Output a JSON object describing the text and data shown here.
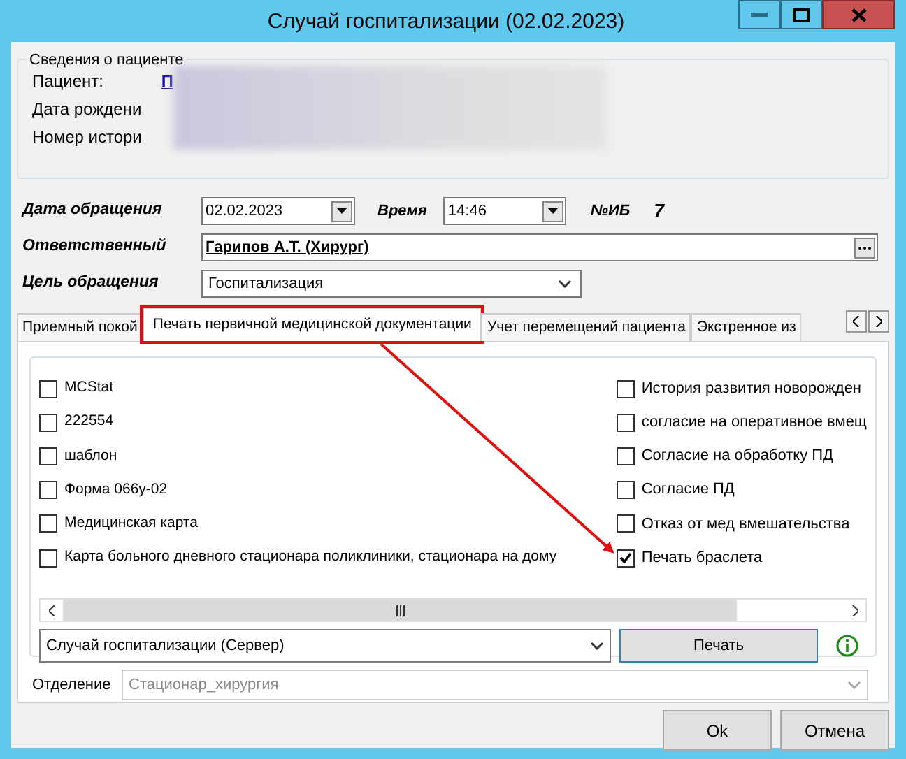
{
  "window": {
    "title": "Случай госпитализации (02.02.2023)"
  },
  "patient_info": {
    "legend": "Сведения о пациенте",
    "rows": [
      {
        "label": "Пациент:",
        "value": "П"
      },
      {
        "label": "Дата рождени"
      },
      {
        "label": "Номер истори"
      }
    ]
  },
  "visit": {
    "date_label": "Дата обращения",
    "date": "02.02.2023",
    "time_label": "Время",
    "time": "14:46",
    "ib_label": "№ИБ",
    "ib": "7",
    "responsible_label": "Ответственный",
    "responsible": "Гарипов А.Т. (Хирург)",
    "purpose_label": "Цель обращения",
    "purpose": "Госпитализация"
  },
  "tabs": [
    {
      "label": "Приемный покой",
      "selected": false,
      "highlighted": false
    },
    {
      "label": "Печать первичной медицинской документации",
      "selected": true,
      "highlighted": true
    },
    {
      "label": "Учет перемещений пациента",
      "selected": false,
      "highlighted": false
    },
    {
      "label": "Экстренное из",
      "selected": false,
      "highlighted": false
    }
  ],
  "documents": {
    "left": [
      {
        "label": "MCStat",
        "checked": false
      },
      {
        "label": "222554",
        "checked": false
      },
      {
        "label": "шаблон",
        "checked": false
      },
      {
        "label": "Форма 066у-02",
        "checked": false
      },
      {
        "label": "Медицинская карта",
        "checked": false
      },
      {
        "label": "Карта больного дневного стационара поликлиники, стационара на дому",
        "checked": false
      }
    ],
    "right": [
      {
        "label": "История развития новорожден",
        "checked": false
      },
      {
        "label": "согласие на оперативное вмещ",
        "checked": false
      },
      {
        "label": "Согласие на обработку ПД",
        "checked": false
      },
      {
        "label": "Согласие ПД",
        "checked": false
      },
      {
        "label": "Отказ от мед вмешательства",
        "checked": false
      },
      {
        "label": "Печать браслета",
        "checked": true,
        "pointed": true
      }
    ]
  },
  "print": {
    "template": "Случай госпитализации (Сервер)",
    "button": "Печать"
  },
  "department": {
    "label": "Отделение",
    "value": "Стационар_хирургия",
    "disabled": true
  },
  "buttons": [
    "Ok",
    "Отмена"
  ]
}
